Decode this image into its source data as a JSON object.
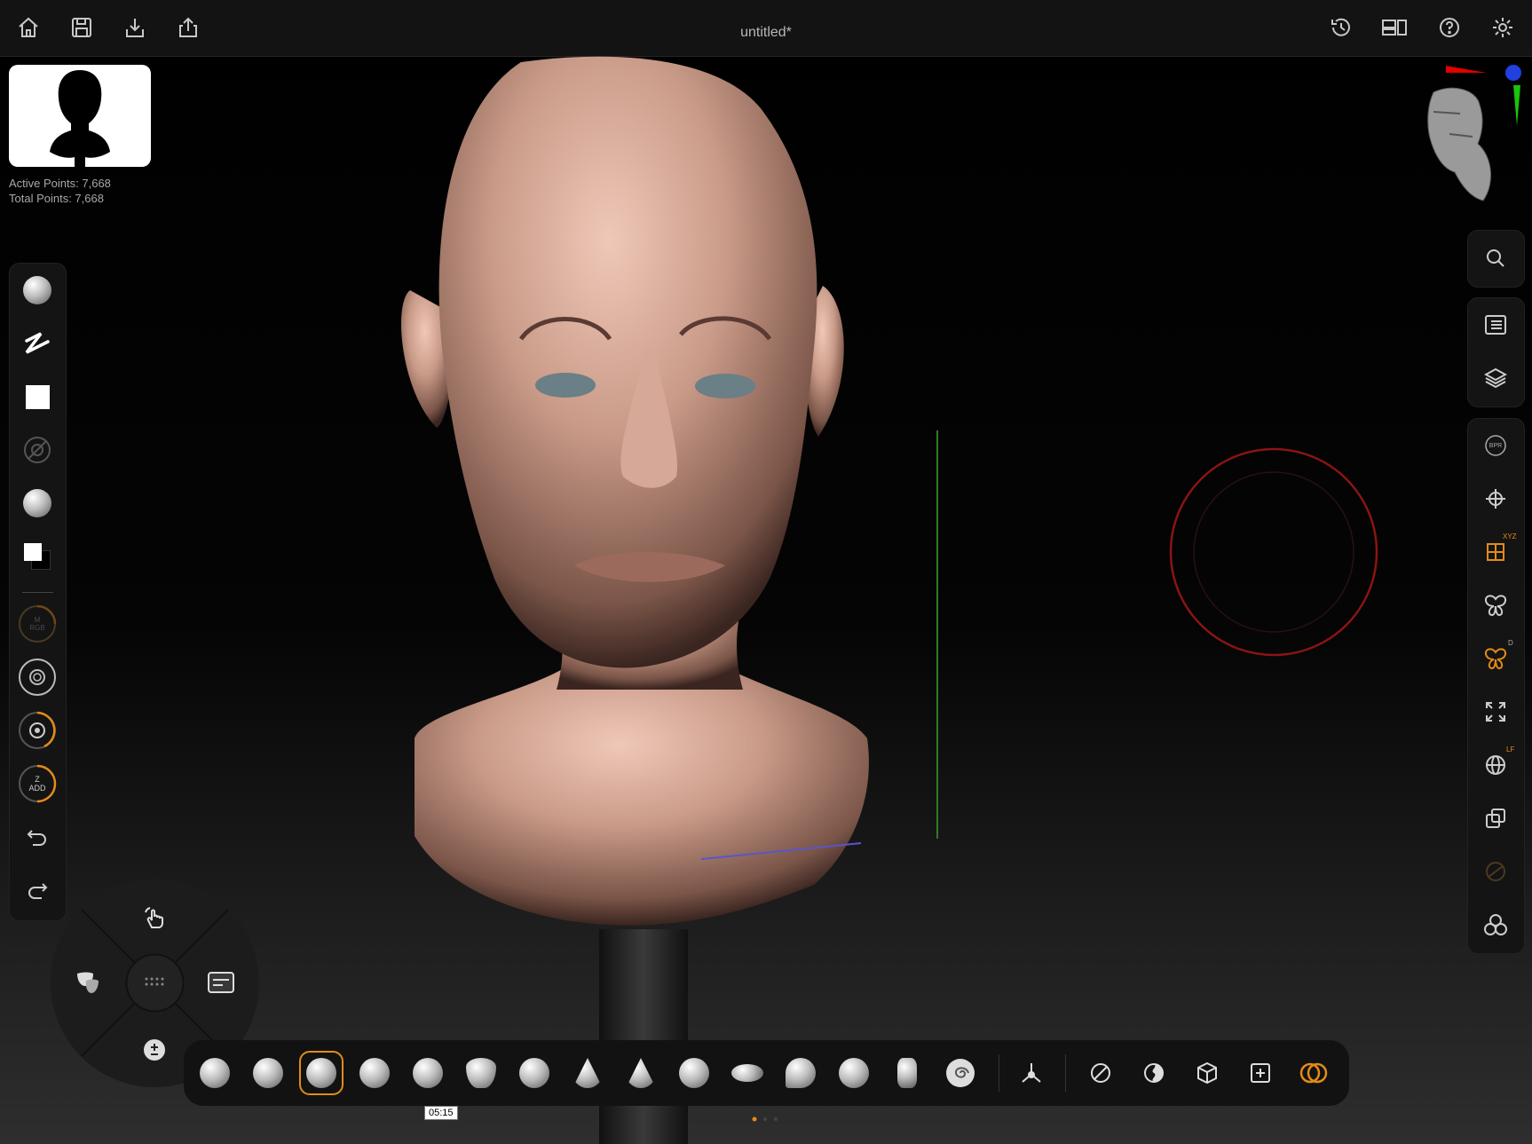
{
  "document": {
    "title": "untitled*"
  },
  "stats": {
    "active_points": "Active Points: 7,668",
    "total_points": "Total Points: 7,668"
  },
  "top_left_icons": [
    "home-icon",
    "save-icon",
    "import-icon",
    "share-icon"
  ],
  "top_right_icons": [
    "history-icon",
    "layout-icon",
    "help-icon",
    "settings-icon"
  ],
  "left_toolbar": {
    "items": [
      "brush-ball-icon",
      "stroke-icon",
      "alpha-square-icon",
      "texture-disabled-icon",
      "material-sphere-icon",
      "color-swatch-icon",
      "rgb-dial",
      "focal-dial",
      "intensity-dial",
      "z-add-dial",
      "undo-icon",
      "redo-icon"
    ],
    "rgb_label": "M RGB",
    "zadd_label": "Z ADD"
  },
  "right_toolbar": {
    "items": [
      "search-icon",
      "menu-list-icon",
      "layers-icon",
      "bpr-icon",
      "move-frame-icon",
      "xyz-symmetry-icon",
      "symmetry-icon",
      "radial-symmetry-icon",
      "fit-icon",
      "local-icon",
      "duplicate-icon",
      "dynamic-icon",
      "polyframe-icon"
    ],
    "bpr_label": "BPR",
    "xyz_label": "XYZ",
    "d_label": "D",
    "lf_label": "LF"
  },
  "radial_menu": {
    "items": [
      "gesture-hand-icon",
      "mask-icon",
      "overlay-panel-icon",
      "plus-minus-icon",
      "grid-dots-icon"
    ]
  },
  "brush_shelf": {
    "brushes": [
      "smooth",
      "inflate",
      "clay-buildup",
      "standard",
      "dam-standard",
      "move",
      "snakehook",
      "trim-dynamic",
      "flatten",
      "sphere",
      "orb-cracks",
      "pinch",
      "clay-tubes",
      "chisel",
      "spiral"
    ],
    "active_index": 2,
    "actions": [
      "gizmo",
      "backface",
      "solo",
      "wireframe",
      "frame",
      "transparency"
    ]
  },
  "tooltip": {
    "time": "05:15"
  },
  "colors": {
    "accent": "#e38b17",
    "skin": "#c99a88",
    "panel": "#141414",
    "cursor_ring": "#8b1414"
  }
}
